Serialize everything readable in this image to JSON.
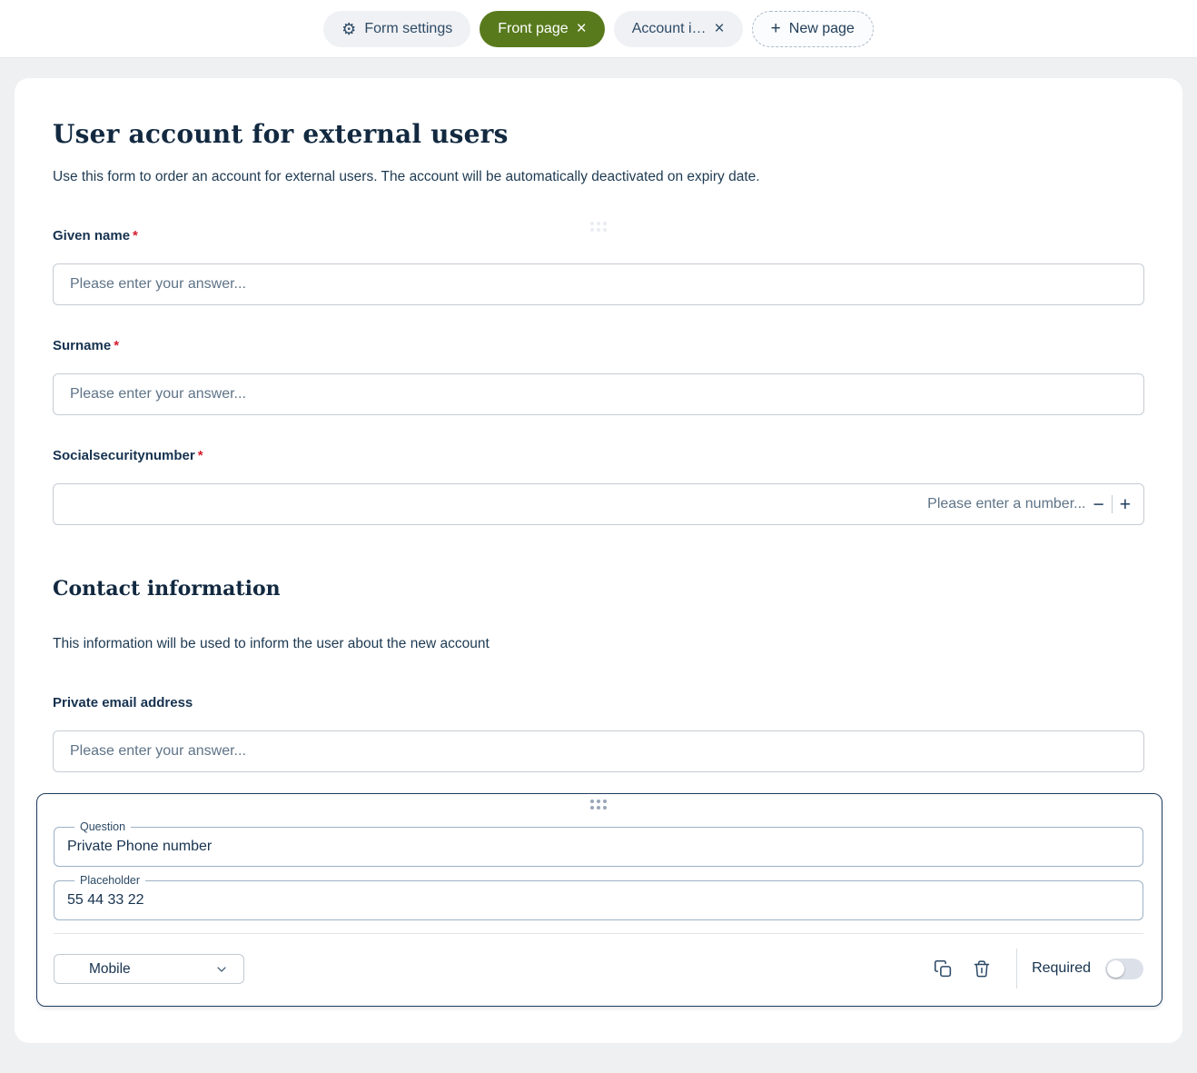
{
  "colors": {
    "accent_green": "#587a1c",
    "navy_text": "#16324f",
    "selected_outline": "#1e3d5c",
    "required_red": "#d41e2f",
    "page_bg": "#eff0f2"
  },
  "icons": {
    "gear": "⚙",
    "close": "×",
    "plus": "+",
    "minus": "−"
  },
  "tabbar": {
    "form_settings": "Form settings",
    "front_page": "Front page",
    "account_page": "Account i…",
    "new_page": "New page"
  },
  "form": {
    "title": "User account for external users",
    "description": "Use this form to order an account for external users. The account will be automatically deactivated on expiry date.",
    "questions": [
      {
        "label": "Given name",
        "required_mark": "*",
        "placeholder": "Please enter your answer..."
      },
      {
        "label": "Surname",
        "required_mark": "*",
        "placeholder": "Please enter your answer..."
      },
      {
        "label": "Socialsecuritynumber",
        "required_mark": "*",
        "placeholder": "Please enter a number..."
      }
    ],
    "section": {
      "heading": "Contact information",
      "note": "This information will be used to inform the user about the new account"
    },
    "email_question": {
      "label": "Private email address",
      "placeholder": "Please enter your answer..."
    }
  },
  "editor": {
    "question_label": "Question",
    "question_value": "Private Phone number",
    "placeholder_label": "Placeholder",
    "placeholder_value": "55 44 33 22",
    "type_selected": "Mobile",
    "required_label": "Required",
    "required_state": "off"
  }
}
